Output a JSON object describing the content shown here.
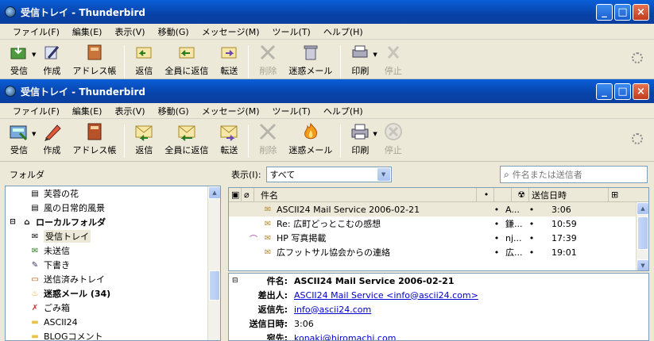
{
  "back_window": {
    "title": "受信トレイ - Thunderbird",
    "menus": [
      "ファイル(F)",
      "編集(E)",
      "表示(V)",
      "移動(G)",
      "メッセージ(M)",
      "ツール(T)",
      "ヘルプ(H)"
    ],
    "toolbar": [
      "受信",
      "作成",
      "アドレス帳",
      "返信",
      "全員に返信",
      "転送",
      "削除",
      "迷惑メール",
      "印刷",
      "停止"
    ]
  },
  "window": {
    "title": "受信トレイ - Thunderbird",
    "menus": [
      "ファイル(F)",
      "編集(E)",
      "表示(V)",
      "移動(G)",
      "メッセージ(M)",
      "ツール(T)",
      "ヘルプ(H)"
    ],
    "toolbar": [
      "受信",
      "作成",
      "アドレス帳",
      "返信",
      "全員に返信",
      "転送",
      "削除",
      "迷惑メール",
      "印刷",
      "停止"
    ]
  },
  "folders": {
    "header": "フォルダ",
    "items": [
      "芙蓉の花",
      "風の日常的風景",
      "ローカルフォルダ",
      "受信トレイ",
      "未送信",
      "下書き",
      "送信済みトレイ",
      "迷惑メール (34)",
      "ごみ箱",
      "ASCII24",
      "BLOGコメント"
    ]
  },
  "filter": {
    "label": "表示(I):",
    "value": "すべて",
    "search_placeholder": "件名または送信者"
  },
  "columns": {
    "subject": "件名",
    "date": "送信日時"
  },
  "messages": [
    {
      "subject": "ASCII24 Mail Service 2006-02-21",
      "sender": "A...",
      "date": "3:06"
    },
    {
      "subject": "Re: 広町どっとこむの感想",
      "sender": "鎌...",
      "date": "10:59"
    },
    {
      "subject": "HP 写真掲載",
      "sender": "nj...",
      "date": "17:39"
    },
    {
      "subject": "広フットサル協会からの連絡",
      "sender": "広...",
      "date": "19:01"
    }
  ],
  "message_header": {
    "subject_label": "件名:",
    "subject": "ASCII24 Mail Service 2006-02-21",
    "from_label": "差出人:",
    "from": "ASCII24 Mail Service <info@ascii24.com>",
    "reply_label": "返信先:",
    "reply": "info@ascii24.com",
    "date_label": "送信日時:",
    "date": "3:06",
    "to_label": "宛先:",
    "to": "konaki@hiromachi.com"
  },
  "colors": {
    "titlebar": "#0842a8",
    "link": "#0000cc"
  }
}
